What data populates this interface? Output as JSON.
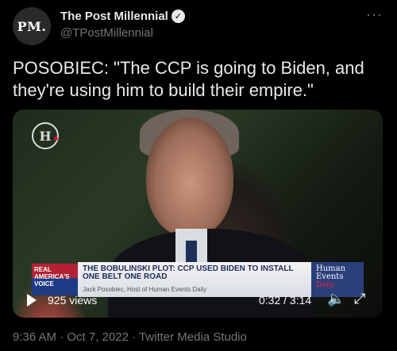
{
  "author": {
    "avatar_text": "PM.",
    "name": "The Post Millennial",
    "handle": "@TPostMillennial"
  },
  "tweet": {
    "text": "POSOBIEC: \"The CCP is going to Biden, and they're using him to build their empire.\""
  },
  "media": {
    "logo_letter": "H",
    "chyron": {
      "channel_lines": "REAL AMERICA'S VOICE",
      "headline": "THE BOBULINSKI PLOT: CCP USED BIDEN TO INSTALL ONE BELT ONE ROAD",
      "subline": "Jack Posobiec, Host of Human Events Daily",
      "brand_line1": "Human",
      "brand_line2": "Events",
      "brand_line3": "Daily"
    },
    "views": "925 views",
    "time": "0:32 / 3:14"
  },
  "footer": {
    "meta": "9:36 AM · Oct 7, 2022 · Twitter Media Studio"
  }
}
